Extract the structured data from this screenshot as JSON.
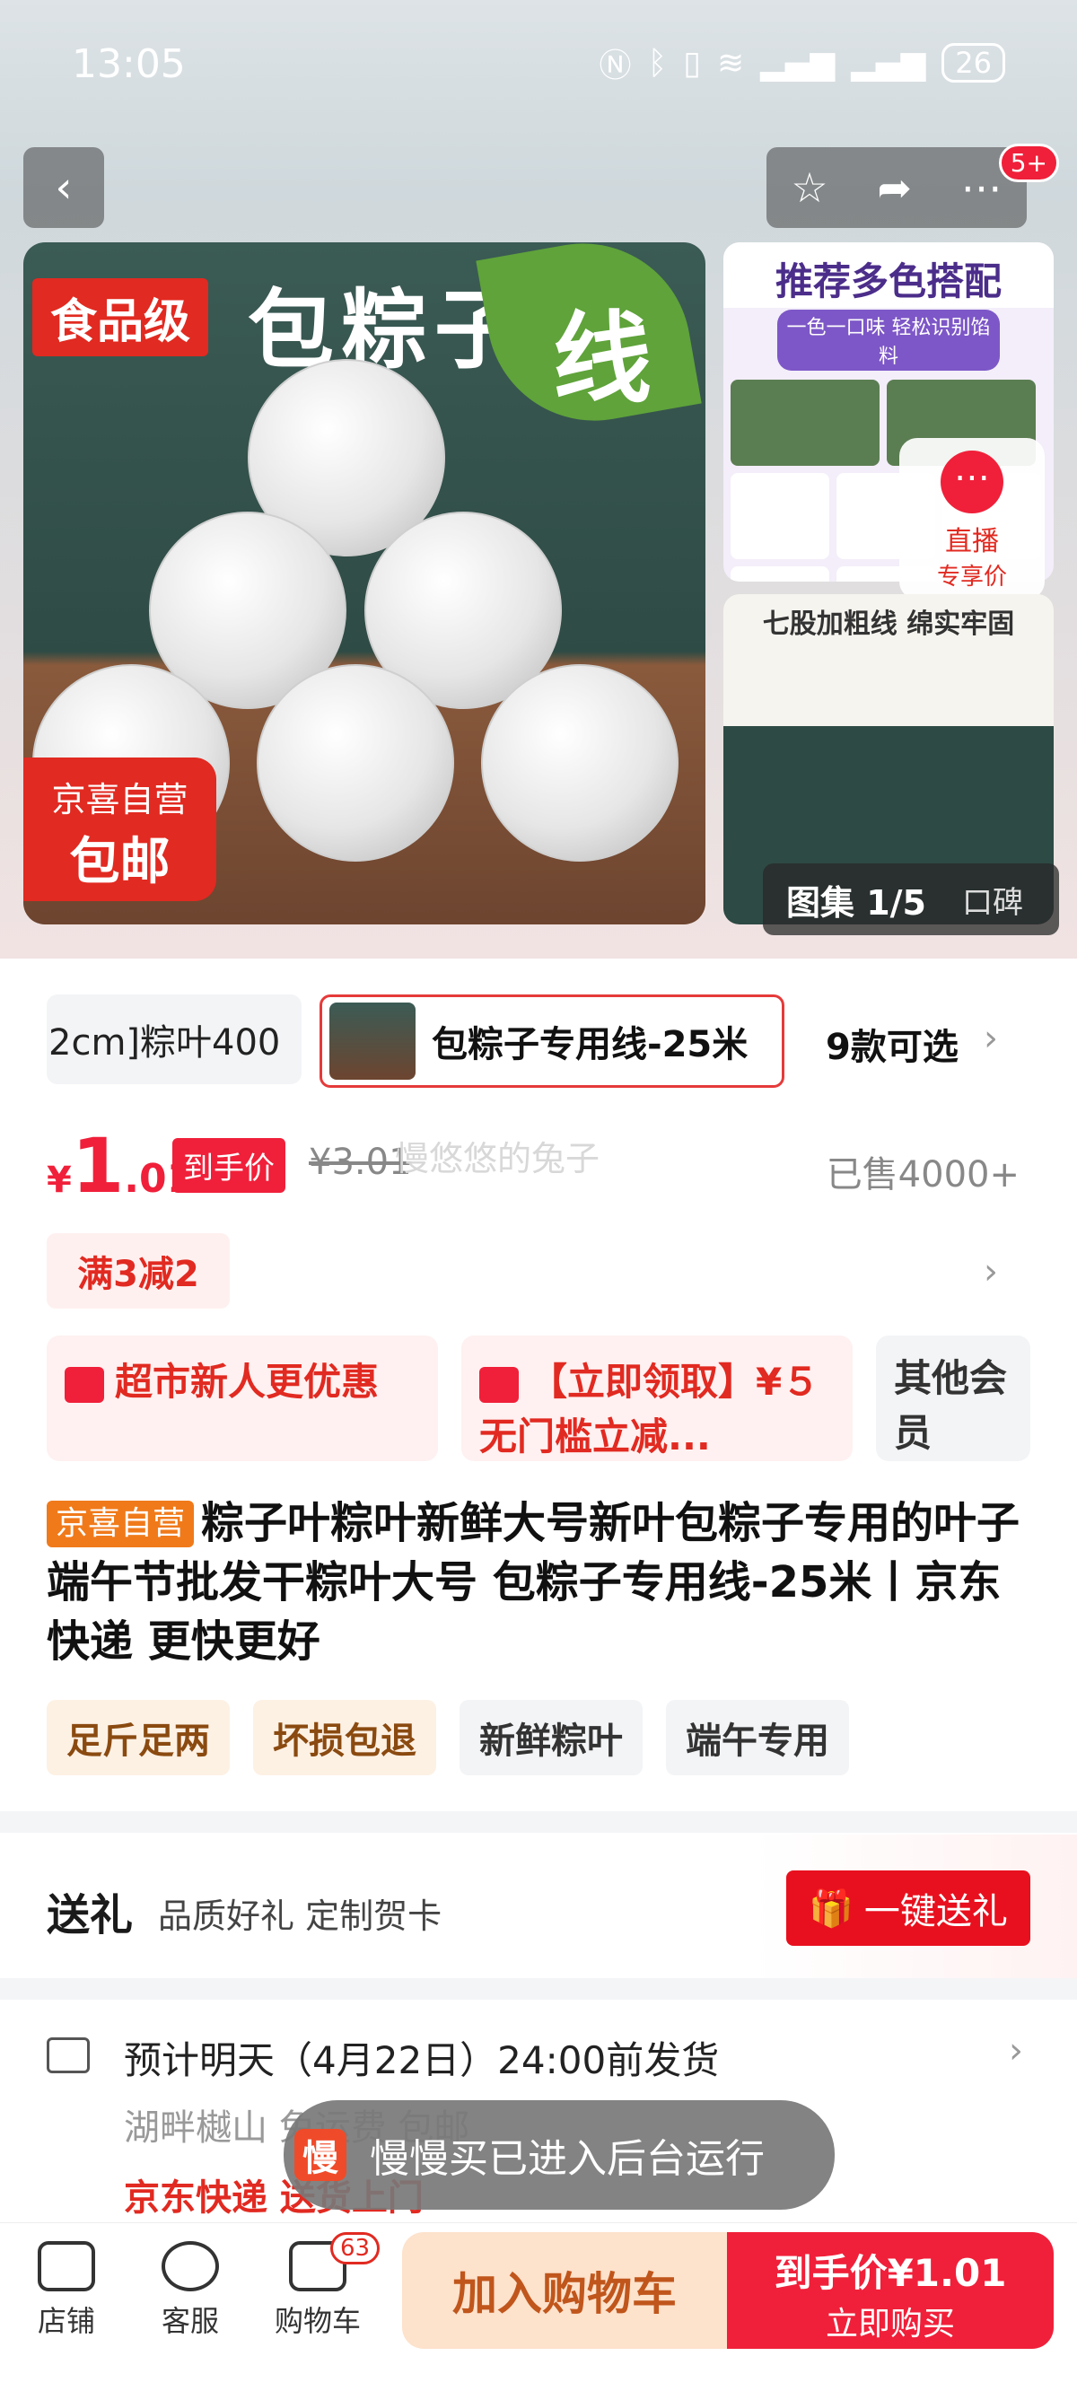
{
  "status_bar": {
    "time": "13:05",
    "battery": "26"
  },
  "top_nav": {
    "notification_count": "5+"
  },
  "hero": {
    "food_grade_label": "食品级",
    "main_title": "包粽子",
    "leaf_char": "线",
    "sticker_line1": "京喜自营",
    "sticker_line2": "包邮",
    "thumb1_title": "推荐多色搭配",
    "thumb1_sub": "一色一口味 轻松识别馅料",
    "thumb2_title": "七股加粗线 绵实牢固",
    "live_label": "直播",
    "live_sub": "专享价",
    "album_label": "图集 1/5",
    "reviews_label": "口碑"
  },
  "variants": {
    "prev_chip": "2cm]粽叶400",
    "selected": "包粽子专用线-25米",
    "count": "9款可选"
  },
  "price": {
    "currency": "¥",
    "integer": "1",
    "decimal": ".01",
    "tag": "到手价",
    "original": "¥3.01",
    "watermark": "慢悠悠的兔子",
    "sold": "已售4000+"
  },
  "promo": {
    "tag": "满3减2"
  },
  "coupons": [
    {
      "text": "超市新人更优惠"
    },
    {
      "text": "【立即领取】¥５ 无门槛立减..."
    },
    {
      "text": "其他会员"
    }
  ],
  "product": {
    "badge": "京喜自营",
    "title": "粽子叶粽叶新鲜大号新叶包粽子专用的叶子端午节批发干粽叶大号 包粽子专用线-25米丨京东快递 更快更好"
  },
  "tags": [
    "足斤足两",
    "坏损包退",
    "新鲜粽叶",
    "端午专用"
  ],
  "gift": {
    "title": "送礼",
    "sub": "品质好礼 定制贺卡",
    "button": "一键送礼"
  },
  "shipping": {
    "line1": "预计明天（4月22日）24:00前发货",
    "line2": "湖畔樾山 免运费 包邮",
    "line3": "京东快递 送货上门"
  },
  "toast": {
    "logo": "慢",
    "text": "慢慢买已进入后台运行"
  },
  "bottom_bar": {
    "store": "店铺",
    "service": "客服",
    "cart": "购物车",
    "cart_count": "63",
    "add_cart": "加入购物车",
    "buy_price": "到手价¥1.01",
    "buy_now": "立即购买"
  },
  "colors": {
    "accent": "#f0203a",
    "brand_orange": "#f07a1a",
    "cart_bg": "#fde2cc"
  }
}
